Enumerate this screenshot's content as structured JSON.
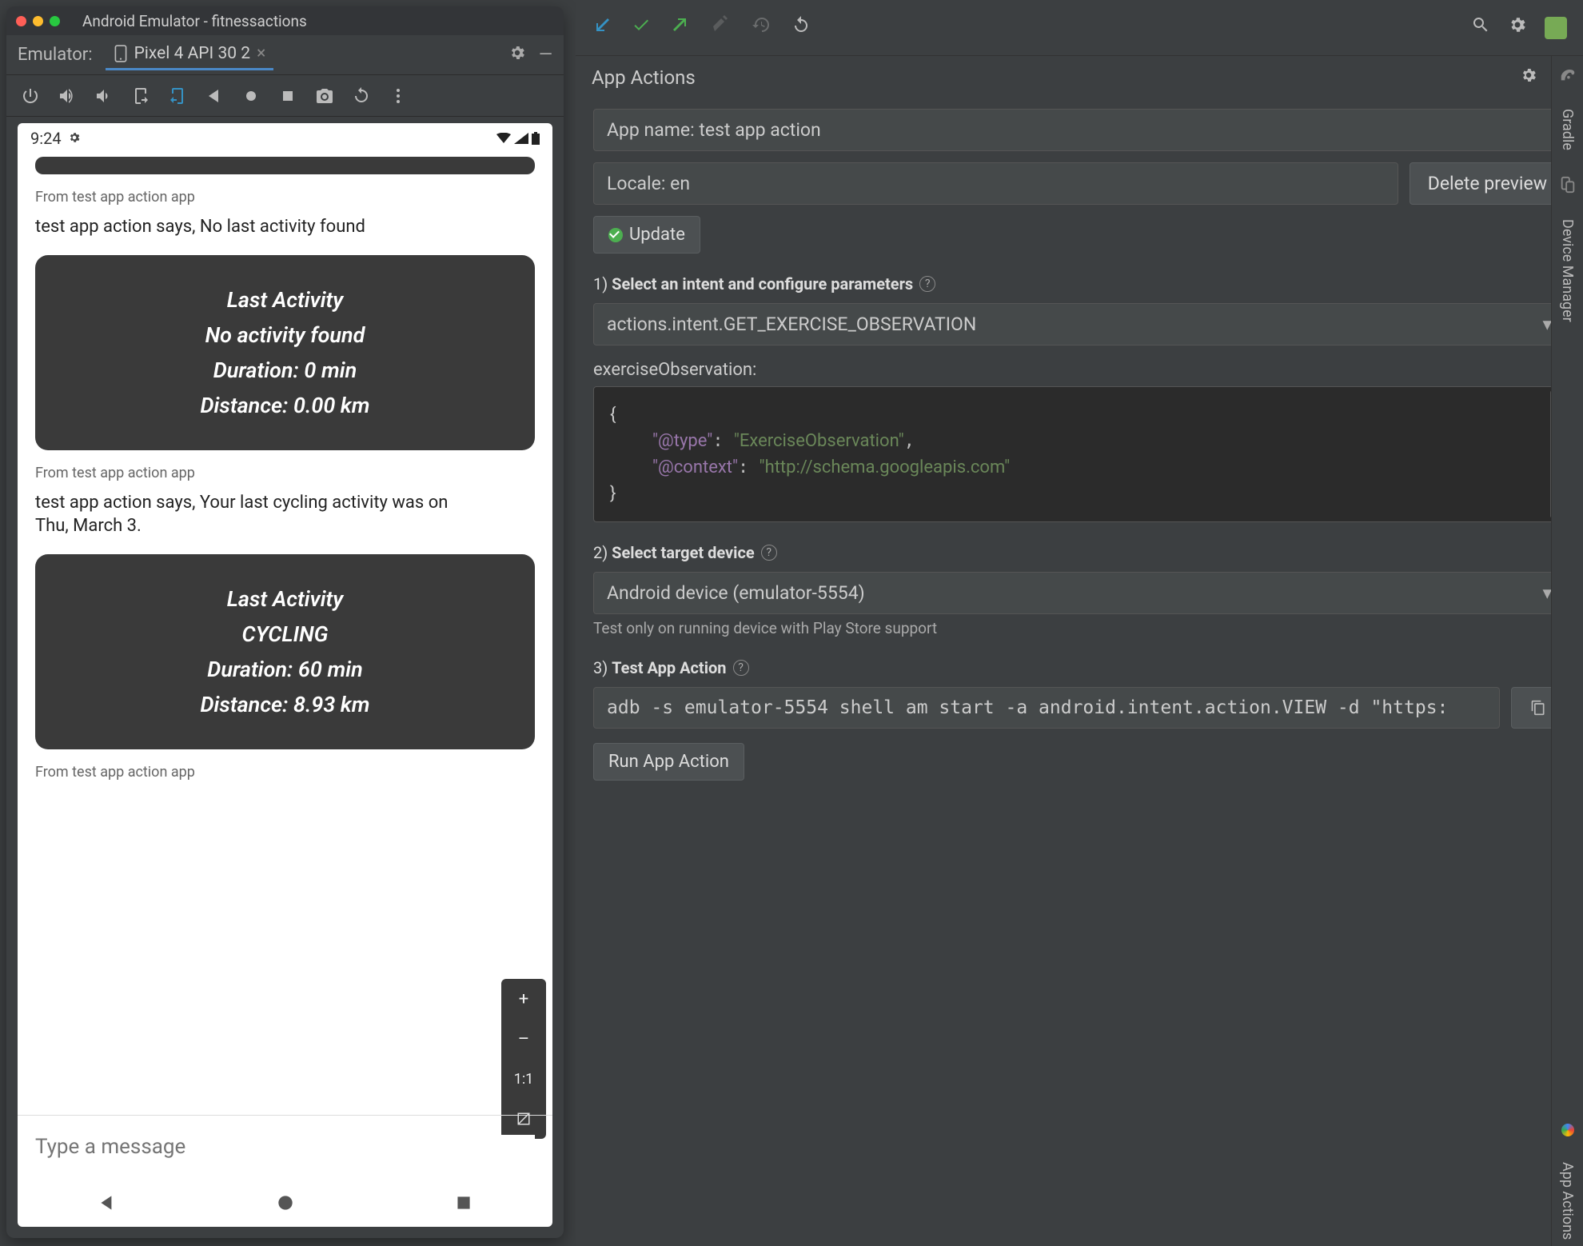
{
  "window_title": "Android Emulator - fitnessactions",
  "emulator": {
    "label": "Emulator:",
    "tab_name": "Pixel 4 API 30 2"
  },
  "phone": {
    "time": "9:24",
    "from_label": "From test app action app",
    "msg1": "test app action says, No last activity found",
    "card1": {
      "title": "Last Activity",
      "line1": "No activity found",
      "line2": "Duration: 0 min",
      "line3": "Distance: 0.00 km"
    },
    "msg2": "test app action says, Your last cycling activity was on Thu, March 3.",
    "card2": {
      "title": "Last Activity",
      "line1": "CYCLING",
      "line2": "Duration: 60 min",
      "line3": "Distance: 8.93 km"
    },
    "zoom_ratio": "1:1",
    "compose_placeholder": "Type a message"
  },
  "app_actions": {
    "panel_title": "App Actions",
    "app_name_field": "App name: test app action",
    "locale_field": "Locale: en",
    "delete_preview": "Delete preview",
    "update": "Update",
    "step1": "Select an intent and configure parameters",
    "intent_value": "actions.intent.GET_EXERCISE_OBSERVATION",
    "param_label": "exerciseObservation:",
    "json_type_key": "\"@type\"",
    "json_type_val": "\"ExerciseObservation\"",
    "json_ctx_key": "\"@context\"",
    "json_ctx_val": "\"http://schema.googleapis.com\"",
    "step2": "Select target device",
    "device_value": "Android device (emulator-5554)",
    "device_hint": "Test only on running device with Play Store support",
    "step3": "Test App Action",
    "adb_cmd": "adb -s emulator-5554 shell am start -a android.intent.action.VIEW -d \"https:",
    "run_btn": "Run App Action"
  },
  "gutter": {
    "gradle": "Gradle",
    "device_mgr": "Device Manager",
    "app_actions": "App Actions"
  }
}
